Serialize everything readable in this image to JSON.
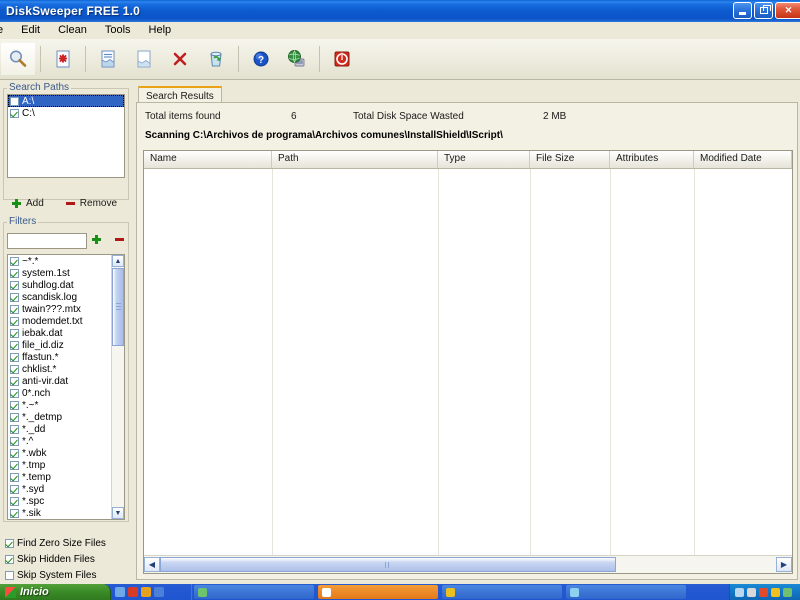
{
  "window": {
    "title": "DiskSweeper FREE 1.0",
    "buttons": {
      "minimize": "minimize-button",
      "restore": "restore-button",
      "close": "close-button"
    }
  },
  "menubar": {
    "items": [
      {
        "label": "e",
        "full": "File"
      },
      {
        "label": "Edit"
      },
      {
        "label": "Clean"
      },
      {
        "label": "Tools"
      },
      {
        "label": "Help"
      }
    ]
  },
  "toolbar": {
    "buttons": [
      {
        "name": "search-icon",
        "glyph": "search"
      },
      {
        "name": "stop-search-icon",
        "glyph": "doc-x"
      },
      {
        "name": "save-report-icon",
        "glyph": "doc-lines"
      },
      {
        "name": "new-report-icon",
        "glyph": "doc-blank"
      },
      {
        "name": "delete-icon",
        "glyph": "x"
      },
      {
        "name": "recycle-bin-icon",
        "glyph": "recycle"
      },
      {
        "name": "help-icon",
        "glyph": "question"
      },
      {
        "name": "web-icon",
        "glyph": "globe"
      },
      {
        "name": "exit-icon",
        "glyph": "power"
      }
    ]
  },
  "search_paths": {
    "title": "Search Paths",
    "items": [
      {
        "label": "A:\\",
        "checked": false,
        "selected": true
      },
      {
        "label": "C:\\",
        "checked": true,
        "selected": false
      }
    ],
    "add_label": "Add",
    "remove_label": "Remove"
  },
  "filters": {
    "title": "Filters",
    "input_value": "",
    "input_placeholder": "",
    "add_label": "+",
    "remove_label": "-",
    "items": [
      {
        "label": "~*.*",
        "checked": true
      },
      {
        "label": "system.1st",
        "checked": true
      },
      {
        "label": "suhdlog.dat",
        "checked": true
      },
      {
        "label": "scandisk.log",
        "checked": true
      },
      {
        "label": "twain???.mtx",
        "checked": true
      },
      {
        "label": "modemdet.txt",
        "checked": true
      },
      {
        "label": "iebak.dat",
        "checked": true
      },
      {
        "label": "file_id.diz",
        "checked": true
      },
      {
        "label": "ffastun.*",
        "checked": true
      },
      {
        "label": "chklist.*",
        "checked": true
      },
      {
        "label": "anti-vir.dat",
        "checked": true
      },
      {
        "label": "0*.nch",
        "checked": true
      },
      {
        "label": "*.~*",
        "checked": true
      },
      {
        "label": "*._detmp",
        "checked": true
      },
      {
        "label": "*._dd",
        "checked": true
      },
      {
        "label": "*.^",
        "checked": true
      },
      {
        "label": "*.wbk",
        "checked": true
      },
      {
        "label": "*.tmp",
        "checked": true
      },
      {
        "label": "*.temp",
        "checked": true
      },
      {
        "label": "*.syd",
        "checked": true
      },
      {
        "label": "*.spc",
        "checked": true
      },
      {
        "label": "*.sik",
        "checked": true
      }
    ]
  },
  "options": [
    {
      "label": "Find Zero Size Files",
      "checked": true
    },
    {
      "label": "Skip Hidden Files",
      "checked": true
    },
    {
      "label": "Skip System Files",
      "checked": false
    }
  ],
  "main": {
    "tabs": [
      {
        "label": "Search Results",
        "active": true
      }
    ],
    "stats": {
      "items_found_label": "Total items found",
      "items_found_value": "6",
      "wasted_label": "Total Disk Space Wasted",
      "wasted_value": "2 MB"
    },
    "scanning_text": "Scanning C:\\Archivos de programa\\Archivos comunes\\InstallShield\\IScript\\",
    "grid": {
      "columns": [
        {
          "label": "Name",
          "width": 128
        },
        {
          "label": "Path",
          "width": 166
        },
        {
          "label": "Type",
          "width": 92
        },
        {
          "label": "File Size",
          "width": 80
        },
        {
          "label": "Attributes",
          "width": 84
        },
        {
          "label": "Modified Date",
          "width": 98
        }
      ],
      "rows": []
    }
  },
  "taskbar": {
    "start_label": "Inicio",
    "tasks": [
      {
        "label": "",
        "active": false
      },
      {
        "label": "",
        "active": true
      },
      {
        "label": "",
        "active": false
      },
      {
        "label": "",
        "active": false
      }
    ],
    "tray_text": ""
  },
  "colors": {
    "title_blue": "#0a54c8",
    "face": "#ece9d8",
    "selection_blue": "#3165c4",
    "tab_accent": "#e8a317",
    "group_label": "#3a5a8c"
  }
}
